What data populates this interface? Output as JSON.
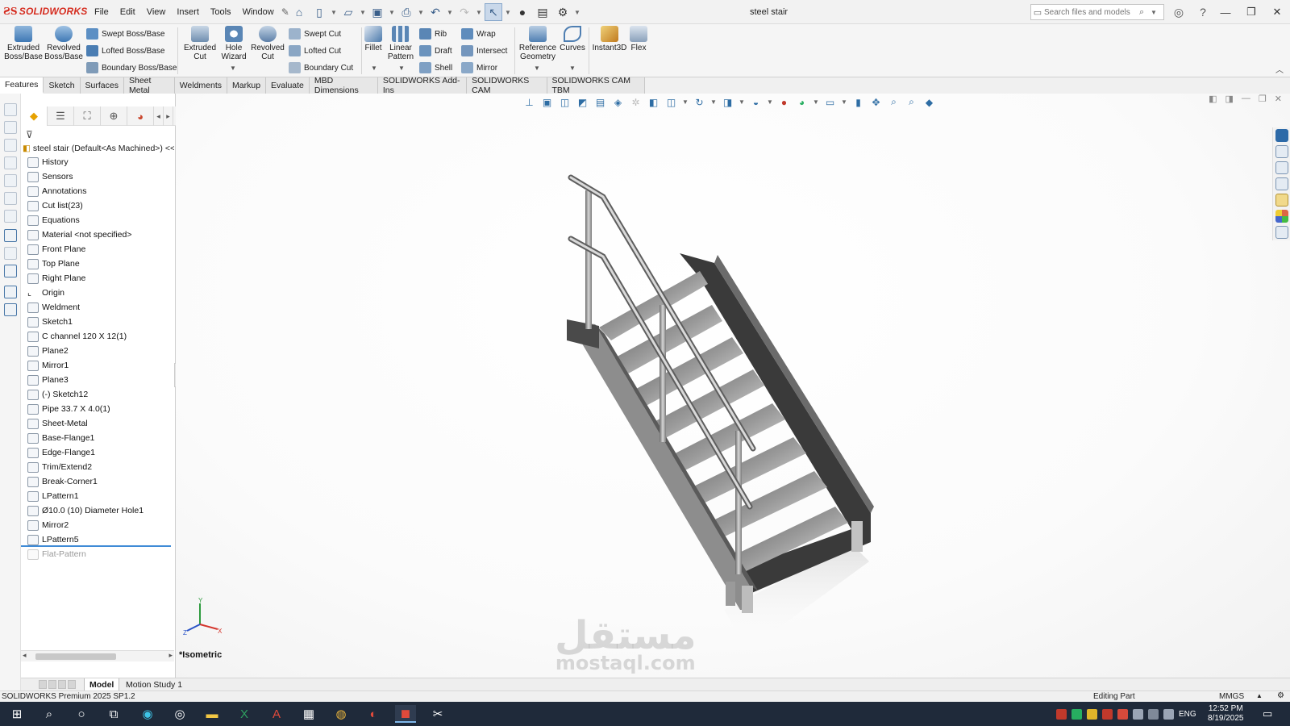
{
  "app": {
    "brand": "SOLIDWORKS",
    "document_title": "steel stair",
    "menus": [
      "File",
      "Edit",
      "View",
      "Insert",
      "Tools",
      "Window"
    ],
    "search_placeholder": "Search files and models"
  },
  "ribbon": {
    "big_buttons": [
      {
        "label1": "Extruded",
        "label2": "Boss/Base"
      },
      {
        "label1": "Revolved",
        "label2": "Boss/Base"
      },
      {
        "label1": "Extruded",
        "label2": "Cut"
      },
      {
        "label1": "Hole",
        "label2": "Wizard"
      },
      {
        "label1": "Revolved",
        "label2": "Cut"
      },
      {
        "label1": "Fillet",
        "label2": ""
      },
      {
        "label1": "Linear",
        "label2": "Pattern"
      },
      {
        "label1": "Reference",
        "label2": "Geometry"
      },
      {
        "label1": "Curves",
        "label2": ""
      },
      {
        "label1": "Instant3D",
        "label2": ""
      },
      {
        "label1": "Flex",
        "label2": ""
      }
    ],
    "small_buttons": {
      "swept_boss": "Swept Boss/Base",
      "lofted_boss": "Lofted Boss/Base",
      "boundary_boss": "Boundary Boss/Base",
      "swept_cut": "Swept Cut",
      "lofted_cut": "Lofted Cut",
      "boundary_cut": "Boundary Cut",
      "rib": "Rib",
      "draft": "Draft",
      "shell": "Shell",
      "wrap": "Wrap",
      "intersect": "Intersect",
      "mirror": "Mirror"
    }
  },
  "command_tabs": [
    "Features",
    "Sketch",
    "Surfaces",
    "Sheet Metal",
    "Weldments",
    "Markup",
    "Evaluate",
    "MBD Dimensions",
    "SOLIDWORKS Add-Ins",
    "SOLIDWORKS CAM",
    "SOLIDWORKS CAM TBM"
  ],
  "feature_tree": {
    "root": "steel stair (Default<As Machined>) <<De",
    "items": [
      "History",
      "Sensors",
      "Annotations",
      "Cut list(23)",
      "Equations",
      "Material <not specified>",
      "Front Plane",
      "Top Plane",
      "Right Plane",
      "Origin",
      "Weldment",
      "Sketch1",
      "C channel 120 X 12(1)",
      "Plane2",
      "Mirror1",
      "Plane3",
      "(-) Sketch12",
      "Pipe 33.7 X 4.0(1)",
      "Sheet-Metal",
      "Base-Flange1",
      "Edge-Flange1",
      "Trim/Extend2",
      "Break-Corner1",
      "LPattern1",
      "Ø10.0 (10) Diameter Hole1",
      "Mirror2",
      "LPattern5"
    ],
    "suppressed_item": "Flat-Pattern"
  },
  "graphics": {
    "view_label": "*Isometric",
    "triad": {
      "x": "X",
      "y": "Y",
      "z": "Z"
    },
    "watermark_1": "مستقل",
    "watermark_2": "mostaql.com"
  },
  "model_tabs": [
    "Model",
    "Motion Study 1"
  ],
  "status": {
    "product": "SOLIDWORKS Premium 2025 SP1.2",
    "mode": "Editing Part",
    "units": "MMGS"
  },
  "taskbar": {
    "language": "ENG",
    "time": "12:52 PM",
    "date": "8/19/2025"
  },
  "colors": {
    "brand_red": "#d52b1e",
    "selection_blue": "#3f8bd6",
    "taskbar": "#1f2a3a"
  }
}
